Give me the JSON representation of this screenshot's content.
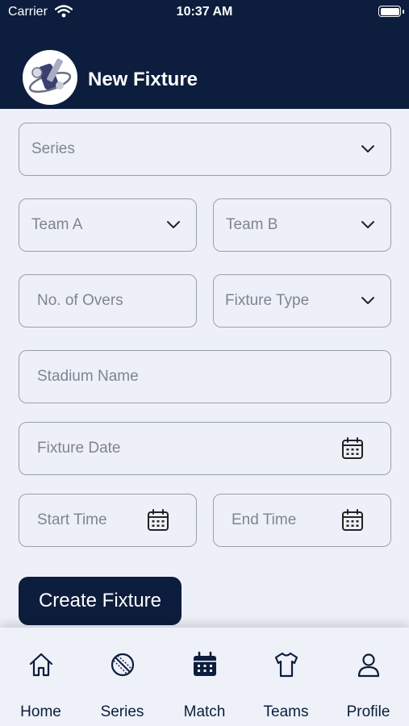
{
  "status_bar": {
    "carrier": "Carrier",
    "time": "10:37 AM"
  },
  "header": {
    "title": "New Fixture"
  },
  "form": {
    "series": {
      "placeholder": "Series"
    },
    "team_a": {
      "placeholder": "Team A"
    },
    "team_b": {
      "placeholder": "Team B"
    },
    "overs": {
      "placeholder": "No. of Overs"
    },
    "fixture_type": {
      "placeholder": "Fixture Type"
    },
    "stadium": {
      "placeholder": "Stadium Name"
    },
    "fixture_date": {
      "placeholder": "Fixture Date"
    },
    "start_time": {
      "placeholder": "Start Time"
    },
    "end_time": {
      "placeholder": "End Time"
    },
    "submit_label": "Create Fixture"
  },
  "tabs": [
    {
      "label": "Home",
      "icon": "home-icon"
    },
    {
      "label": "Series",
      "icon": "ball-icon"
    },
    {
      "label": "Match",
      "icon": "calendar-icon"
    },
    {
      "label": "Teams",
      "icon": "shirt-icon"
    },
    {
      "label": "Profile",
      "icon": "user-icon"
    }
  ],
  "colors": {
    "primary": "#0c1d3d",
    "background": "#edf0f8",
    "border": "#9aa0ab",
    "placeholder": "#7f8590"
  }
}
